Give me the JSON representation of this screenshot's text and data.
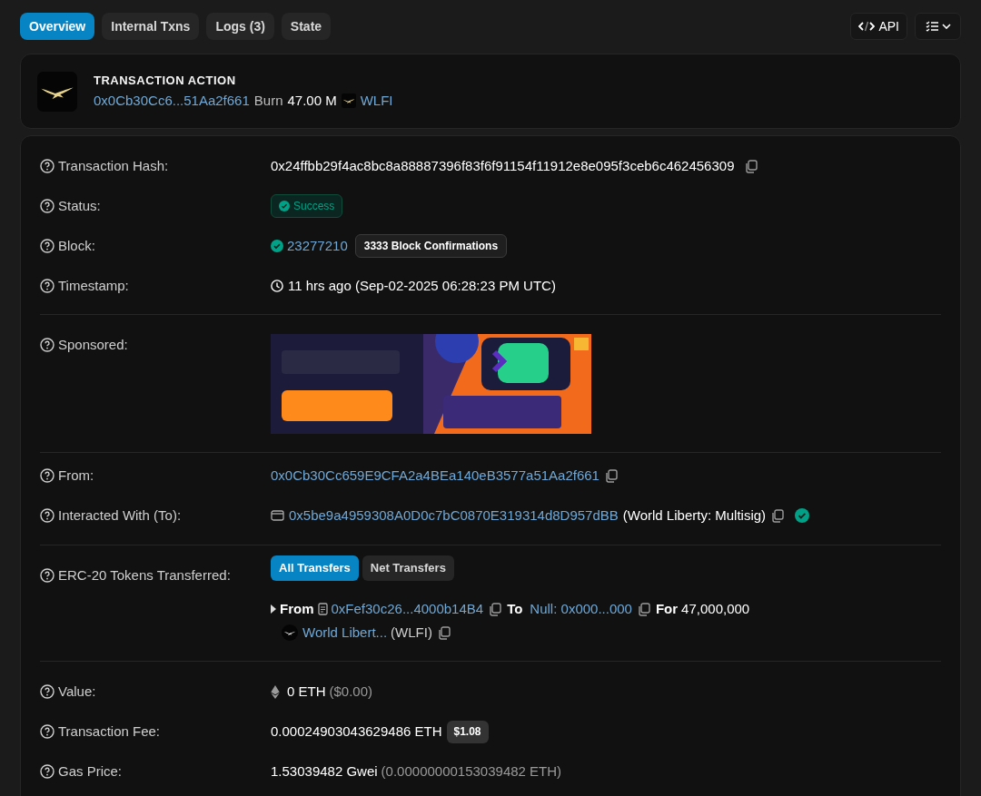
{
  "tabs": [
    {
      "label": "Overview",
      "selected": true
    },
    {
      "label": "Internal Txns",
      "selected": false
    },
    {
      "label": "Logs (3)",
      "selected": false
    },
    {
      "label": "State",
      "selected": false
    }
  ],
  "toolbar": {
    "api_button": "API"
  },
  "transaction_action": {
    "title": "TRANSACTION ACTION",
    "from": "0x0Cb30Cc6...51Aa2f661",
    "verb": "Burn",
    "amount": "47.00 M",
    "token": "WLFI"
  },
  "sections": [
    [
      {
        "kind": "hash",
        "label": "Transaction Hash:",
        "value": "0x24ffbb29f4ac8bc8a88887396f83f6f91154f11912e8e095f3ceb6c462456309"
      },
      {
        "kind": "status",
        "label": "Status:",
        "value": "Success"
      },
      {
        "kind": "block",
        "label": "Block:",
        "number": "23277210",
        "confirmations": "3333 Block Confirmations"
      },
      {
        "kind": "timestamp",
        "label": "Timestamp:",
        "value": "11 hrs ago (Sep-02-2025 06:28:23 PM UTC)"
      }
    ],
    [
      {
        "kind": "sponsored",
        "label": "Sponsored:"
      }
    ],
    [
      {
        "kind": "address",
        "label": "From:",
        "address": "0x0Cb30Cc659E9CFA2a4BEa140eB3577a51Aa2f661"
      },
      {
        "kind": "contract",
        "label": "Interacted With (To):",
        "address": "0x5be9a4959308A0D0c7bC0870E319314d8D957dBB",
        "name": "(World Liberty: Multisig)",
        "verified": true
      }
    ],
    [
      {
        "kind": "transfers",
        "label": "ERC-20 Tokens Transferred:",
        "buttons": [
          {
            "label": "All Transfers",
            "selected": true
          },
          {
            "label": "Net Transfers",
            "selected": false
          }
        ],
        "transfer": {
          "from_label": "From",
          "from": "0xFef30c26...4000b14B4",
          "to_label": "To",
          "to": "Null: 0x000...000",
          "for_label": "For",
          "amount": "47,000,000",
          "token": "World Libert...",
          "symbol": "(WLFI)"
        }
      }
    ],
    [
      {
        "kind": "value",
        "label": "Value:",
        "amount": "0 ETH",
        "usd": "($0.00)"
      },
      {
        "kind": "fee",
        "label": "Transaction Fee:",
        "amount": "0.00024903043629486 ETH",
        "usd": "$1.08"
      },
      {
        "kind": "gas",
        "label": "Gas Price:",
        "amount": "1.53039482 Gwei",
        "eth": "(0.00000000153039482 ETH)"
      }
    ]
  ]
}
